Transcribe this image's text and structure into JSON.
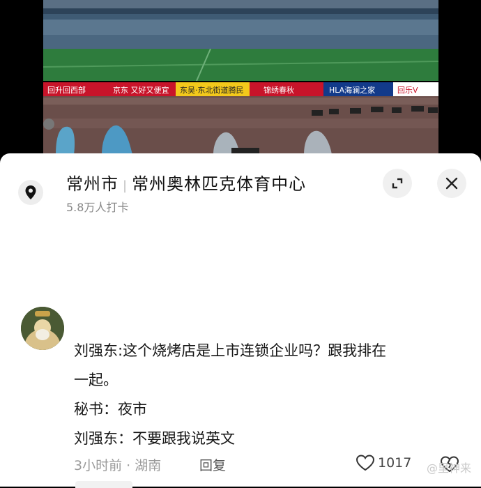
{
  "location": {
    "city": "常州市",
    "venue": "常州奥林匹克体育中心",
    "checkins": "5.8万人打卡"
  },
  "icons": {
    "location": "location-pin-icon",
    "minimize": "minimize-corner-icon",
    "close": "close-icon",
    "like": "heart-icon",
    "dislike": "broken-heart-icon"
  },
  "ads": [
    "回升回西部",
    "京东 又好又便宜",
    "东吴·东北街道腾民",
    "锦绣春秋",
    "HLA海澜之家",
    "回乐V"
  ],
  "comment": {
    "lines": [
      "刘强东:这个烧烤店是上市连锁企业吗？跟我排在",
      "一起。",
      "秘书：夜市",
      "刘强东：不要跟我说英文"
    ],
    "time_location": "3小时前 · 湖南",
    "reply_label": "回复",
    "likes": "1017"
  },
  "watermark": "@里神来"
}
